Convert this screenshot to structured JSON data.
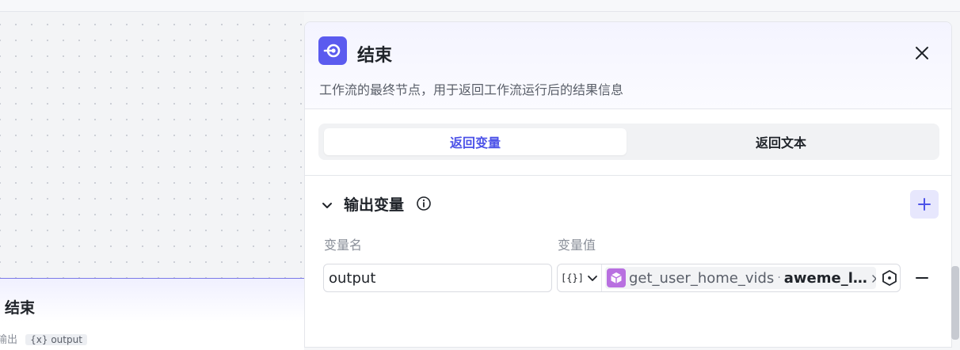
{
  "canvas_node": {
    "title": "结束",
    "output_label": "输出",
    "output_chip": "{x} output"
  },
  "panel": {
    "title": "结束",
    "description": "工作流的最终节点，用于返回工作流运行后的结果信息",
    "tabs": [
      {
        "label": "返回变量",
        "active": true
      },
      {
        "label": "返回文本",
        "active": false
      }
    ],
    "section": {
      "title": "输出变量",
      "columns": {
        "name": "变量名",
        "value": "变量值"
      },
      "rows": [
        {
          "name": "output",
          "type_glyph": "[{}]",
          "ref_node": "get_user_home_vids",
          "ref_sep": "·",
          "ref_field": "aweme_l…"
        }
      ]
    }
  },
  "colors": {
    "accent": "#4d53e8",
    "end_icon_bg": "#5b5bef",
    "ref_icon_bg": "#b86fe0",
    "add_bg": "#e7e7fd"
  },
  "icons": [
    "end-node-icon",
    "close-icon",
    "chevron-down-icon",
    "info-icon",
    "plus-icon",
    "chevron-down-icon",
    "plugin-cube-icon",
    "close-icon",
    "hexagon-dot-icon",
    "minus-icon"
  ]
}
